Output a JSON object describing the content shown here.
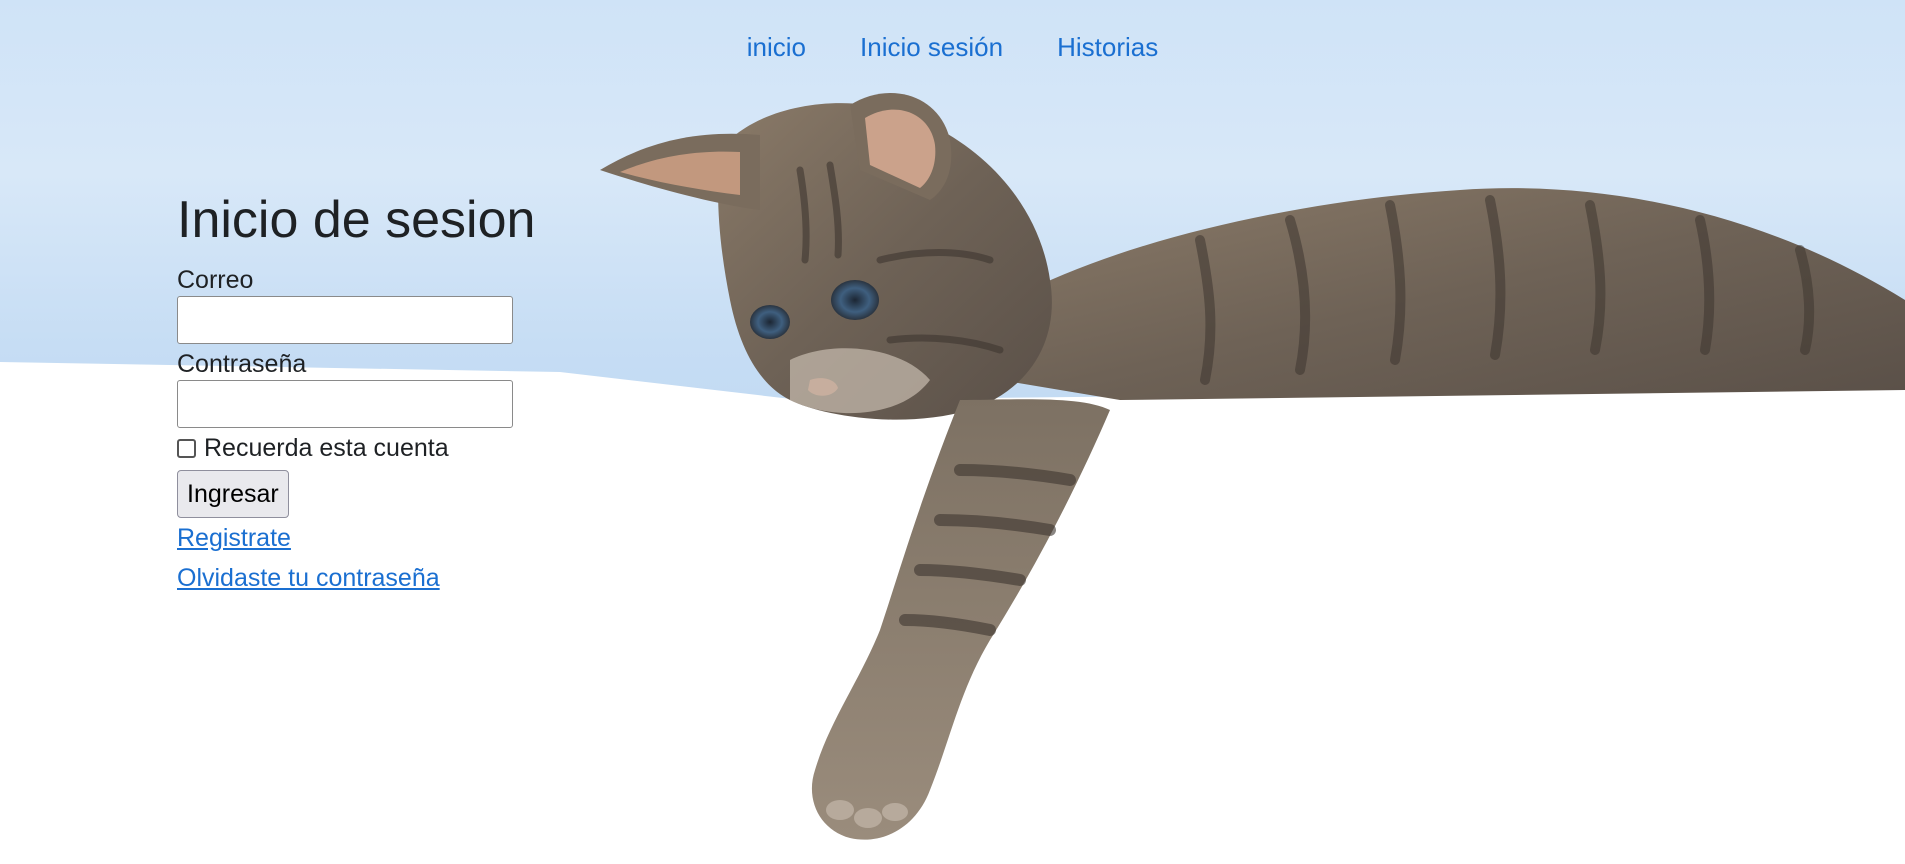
{
  "nav": {
    "items": [
      {
        "label": "inicio"
      },
      {
        "label": "Inicio sesión"
      },
      {
        "label": "Historias"
      }
    ]
  },
  "login": {
    "title": "Inicio de sesion",
    "email_label": "Correo",
    "email_value": "",
    "password_label": "Contraseña",
    "password_value": "",
    "remember_label": "Recuerda esta cuenta",
    "remember_checked": false,
    "submit_label": "Ingresar",
    "register_link": "Registrate",
    "forgot_link": "Olvidaste tu contraseña"
  },
  "colors": {
    "link": "#1a6fd1",
    "text": "#1e2124",
    "sky": "#cfe3f7"
  },
  "background_image": "tabby-kitten-on-white-table"
}
